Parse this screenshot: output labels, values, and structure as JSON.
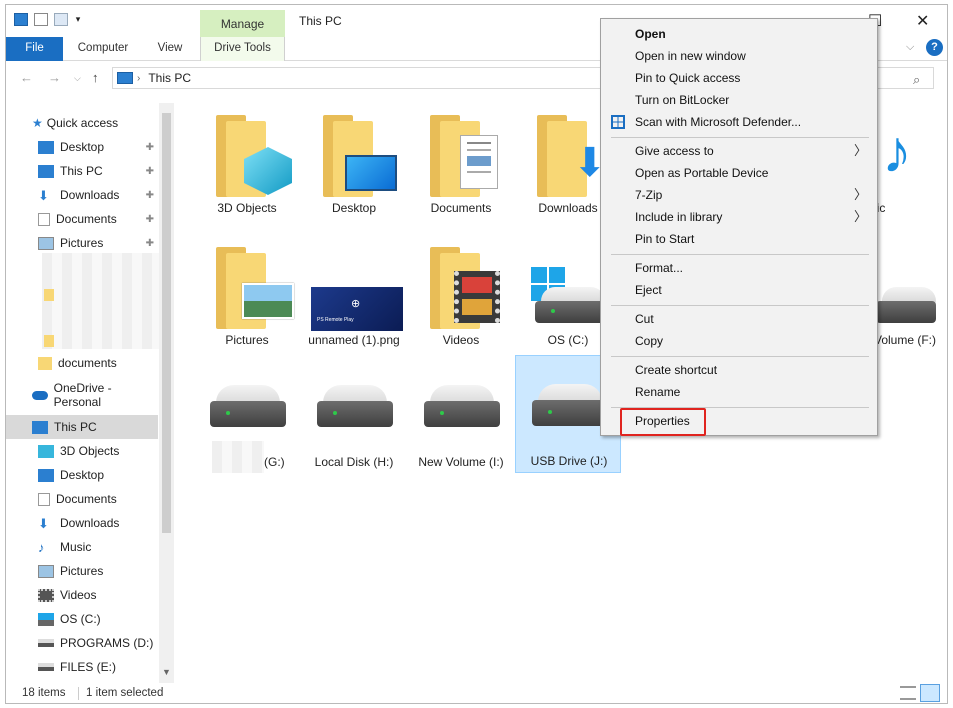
{
  "window": {
    "title": "This PC",
    "contextual_tab_group": "Manage",
    "ribbon_tabs": [
      "File",
      "Computer",
      "View",
      "Drive Tools"
    ],
    "controls": {
      "minimize": "—",
      "maximize": "☐",
      "close": "✕",
      "help": "?"
    }
  },
  "address": {
    "path": "This PC"
  },
  "sidebar": {
    "quick_access": "Quick access",
    "qa_items": [
      "Desktop",
      "This PC",
      "Downloads",
      "Documents",
      "Pictures",
      "documents"
    ],
    "onedrive": "OneDrive - Personal",
    "this_pc": "This PC",
    "pc_items": [
      "3D Objects",
      "Desktop",
      "Documents",
      "Downloads",
      "Music",
      "Pictures",
      "Videos",
      "OS (C:)",
      "PROGRAMS (D:)",
      "FILES (E:)"
    ]
  },
  "content": {
    "folders": [
      {
        "label": "3D Objects",
        "icon": "3d-cube-icon"
      },
      {
        "label": "Desktop",
        "icon": "monitor-icon"
      },
      {
        "label": "Documents",
        "icon": "document-icon"
      },
      {
        "label": "Downloads",
        "icon": "download-arrow-icon"
      },
      {
        "label": "Music",
        "icon": "music-note-icon"
      }
    ],
    "row2": [
      {
        "label": "Pictures"
      },
      {
        "label": "unnamed (1).png",
        "thumb_text": "PS Remote Play"
      },
      {
        "label": "Videos"
      },
      {
        "label": "OS (C:)"
      },
      {
        "label": "Volume (F:)"
      }
    ],
    "row3": [
      {
        "label": "(G:)"
      },
      {
        "label": "Local Disk (H:)"
      },
      {
        "label": "New Volume (I:)"
      },
      {
        "label": "USB Drive (J:)",
        "selected": true
      }
    ]
  },
  "context_menu": {
    "items": [
      {
        "label": "Open",
        "bold": true
      },
      {
        "label": "Open in new window"
      },
      {
        "label": "Pin to Quick access"
      },
      {
        "label": "Turn on BitLocker"
      },
      {
        "label": "Scan with Microsoft Defender...",
        "icon": "defender-shield-icon"
      },
      {
        "label": "Give access to",
        "submenu": true
      },
      {
        "label": "Open as Portable Device"
      },
      {
        "label": "7-Zip",
        "submenu": true
      },
      {
        "label": "Include in library",
        "submenu": true
      },
      {
        "label": "Pin to Start"
      },
      {
        "label": "Format..."
      },
      {
        "label": "Eject"
      },
      {
        "label": "Cut"
      },
      {
        "label": "Copy"
      },
      {
        "label": "Create shortcut"
      },
      {
        "label": "Rename"
      },
      {
        "label": "Properties",
        "highlighted": true
      }
    ],
    "submenu_arrow": "〉"
  },
  "status": {
    "items": "18 items",
    "selected": "1 item selected"
  },
  "colors": {
    "accent": "#1a6ec2",
    "manage_tab": "#d6efc0",
    "selection": "#cce8ff",
    "highlight_box": "#e0241f",
    "folder": "#f8d775"
  }
}
